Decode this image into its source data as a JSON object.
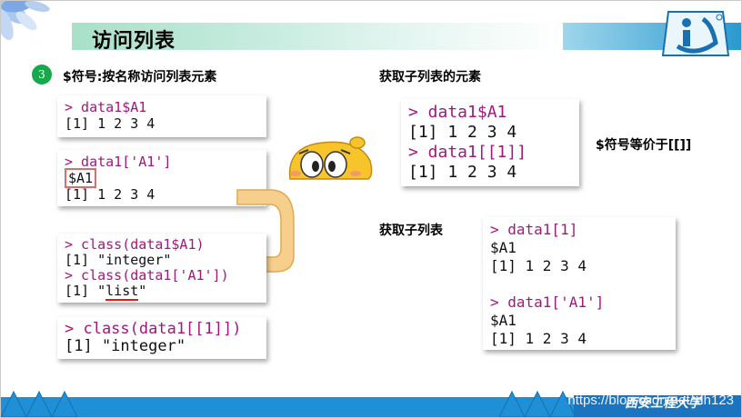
{
  "title": "访问列表",
  "bullet_number": "3",
  "headings": {
    "dollar_access": "$符号:按名称访问列表元素",
    "get_element": "获取子列表的元素",
    "equivalent": "$符号等价于[[]]",
    "get_sublist": "获取子列表"
  },
  "code_blocks": {
    "b1": {
      "l1": "> data1$A1",
      "l2": "[1] 1 2 3 4"
    },
    "b2": {
      "l1": "> data1['A1']",
      "l2": "$A1",
      "l3": "[1] 1 2 3 4"
    },
    "b3": {
      "l1": "> class(data1$A1)",
      "l2": "[1] \"integer\"",
      "l3": "> class(data1['A1'])",
      "l4a": "[1] \"",
      "l4b": "list",
      "l4c": "\""
    },
    "b4": {
      "l1": "> class(data1[[1]])",
      "l2": "[1] \"integer\""
    },
    "b5": {
      "l1": "> data1$A1",
      "l2": "[1] 1 2 3 4",
      "l3": "> data1[[1]]",
      "l4": "[1] 1 2 3 4"
    },
    "b6": {
      "l1": "> data1[1]",
      "l2": "$A1",
      "l3": "[1] 1 2 3 4",
      "l4": "> data1['A1']",
      "l5": "$A1",
      "l6": "[1] 1 2 3 4"
    }
  },
  "footer": {
    "university": "西安工程大学",
    "url": "https://blog.csdn.net/xlh123"
  },
  "colors": {
    "command": "#a0197a",
    "accent_green": "#17a84b",
    "footer_blue": "#1f8fd6"
  },
  "icons": [
    "corner-flower-icon",
    "university-logo-icon",
    "emoji-face-icon",
    "curved-arrow-icon"
  ]
}
